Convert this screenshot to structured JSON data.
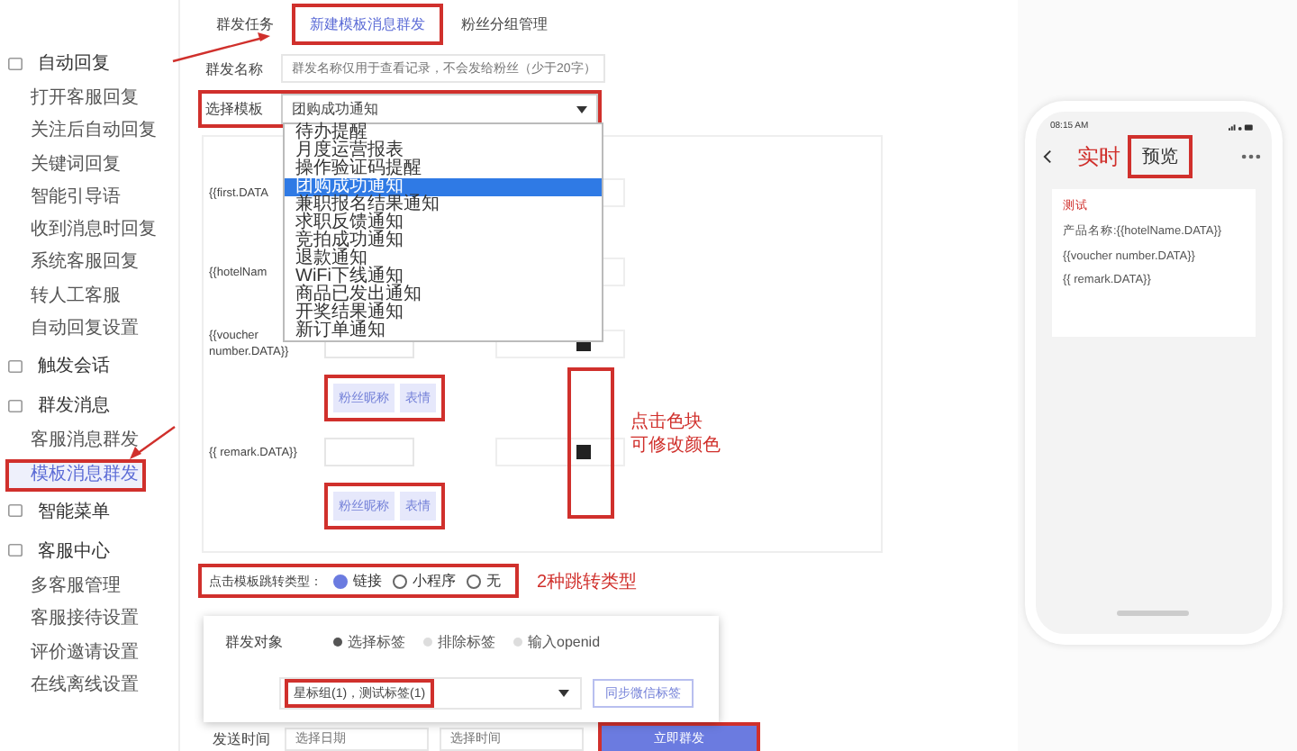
{
  "sidebar": {
    "sections": [
      {
        "label": "自动回复",
        "children": [
          {
            "label": "打开客服回复",
            "selected": false
          },
          {
            "label": "关注后自动回复",
            "selected": false
          },
          {
            "label": "关键词回复",
            "selected": false
          },
          {
            "label": "智能引导语",
            "selected": false
          },
          {
            "label": "收到消息时回复",
            "selected": false
          },
          {
            "label": "系统客服回复",
            "selected": false
          },
          {
            "label": "转人工客服",
            "selected": false
          },
          {
            "label": "自动回复设置",
            "selected": false
          }
        ]
      },
      {
        "label": "触发会话"
      },
      {
        "label": "群发消息",
        "children": [
          {
            "label": "客服消息群发",
            "selected": false
          },
          {
            "label": "模板消息群发",
            "selected": true
          }
        ]
      },
      {
        "label": "智能菜单"
      },
      {
        "label": "客服中心",
        "children": [
          {
            "label": "多客服管理",
            "selected": false
          },
          {
            "label": "客服接待设置",
            "selected": false
          },
          {
            "label": "评价邀请设置",
            "selected": false
          },
          {
            "label": "在线离线设置",
            "selected": false
          }
        ]
      }
    ]
  },
  "tabs": [
    {
      "label": "群发任务",
      "selected": false
    },
    {
      "label": "新建模板消息群发",
      "selected": true
    },
    {
      "label": "粉丝分组管理",
      "selected": false
    }
  ],
  "name_field": {
    "label": "群发名称",
    "placeholder": "群发名称仅用于查看记录，不会发给粉丝（少于20字）"
  },
  "template_select": {
    "label": "选择模板",
    "value": "团购成功通知",
    "options": [
      {
        "label": "待办提醒",
        "selected": false
      },
      {
        "label": "月度运营报表",
        "selected": false
      },
      {
        "label": "操作验证码提醒",
        "selected": false
      },
      {
        "label": "团购成功通知",
        "selected": true
      },
      {
        "label": "兼职报名结果通知",
        "selected": false
      },
      {
        "label": "求职反馈通知",
        "selected": false
      },
      {
        "label": "竞拍成功通知",
        "selected": false
      },
      {
        "label": "退款通知",
        "selected": false
      },
      {
        "label": "WiFi下线通知",
        "selected": false
      },
      {
        "label": "商品已发出通知",
        "selected": false
      },
      {
        "label": "开奖结果通知",
        "selected": false
      },
      {
        "label": "新订单通知",
        "selected": false
      }
    ]
  },
  "fields": [
    {
      "label": "{{first.DATA"
    },
    {
      "label": "{{hotelNam"
    },
    {
      "label": "{{voucher number.DATA}}",
      "color": "#222222",
      "tags": [
        "粉丝昵称",
        "表情"
      ]
    },
    {
      "label": "{{ remark.DATA}}",
      "color": "#222222",
      "tags": [
        "粉丝昵称",
        "表情"
      ]
    }
  ],
  "color_note": [
    "点击色块",
    "可修改颜色"
  ],
  "jump_type": {
    "label": "点击模板跳转类型：",
    "options": [
      {
        "label": "链接",
        "selected": true
      },
      {
        "label": "小程序",
        "selected": false
      },
      {
        "label": "无",
        "selected": false
      }
    ],
    "note": "2种跳转类型"
  },
  "audience": {
    "label": "群发对象",
    "options": [
      {
        "label": "选择标签",
        "selected": true
      },
      {
        "label": "排除标签",
        "selected": false
      },
      {
        "label": "输入openid",
        "selected": false
      }
    ],
    "tags_value": "星标组(1)，测试标签(1)",
    "sync_button": "同步微信标签"
  },
  "send_time": {
    "label": "发送时间",
    "date_placeholder": "选择日期",
    "time_placeholder": "选择时间",
    "submit": "立即群发"
  },
  "phone": {
    "time": "08:15 AM",
    "note": "实时",
    "title": "预览",
    "card_title": "测试",
    "lines": [
      "产品名称:{{hotelName.DATA}}",
      "{{voucher number.DATA}}",
      "{{ remark.DATA}}"
    ]
  }
}
